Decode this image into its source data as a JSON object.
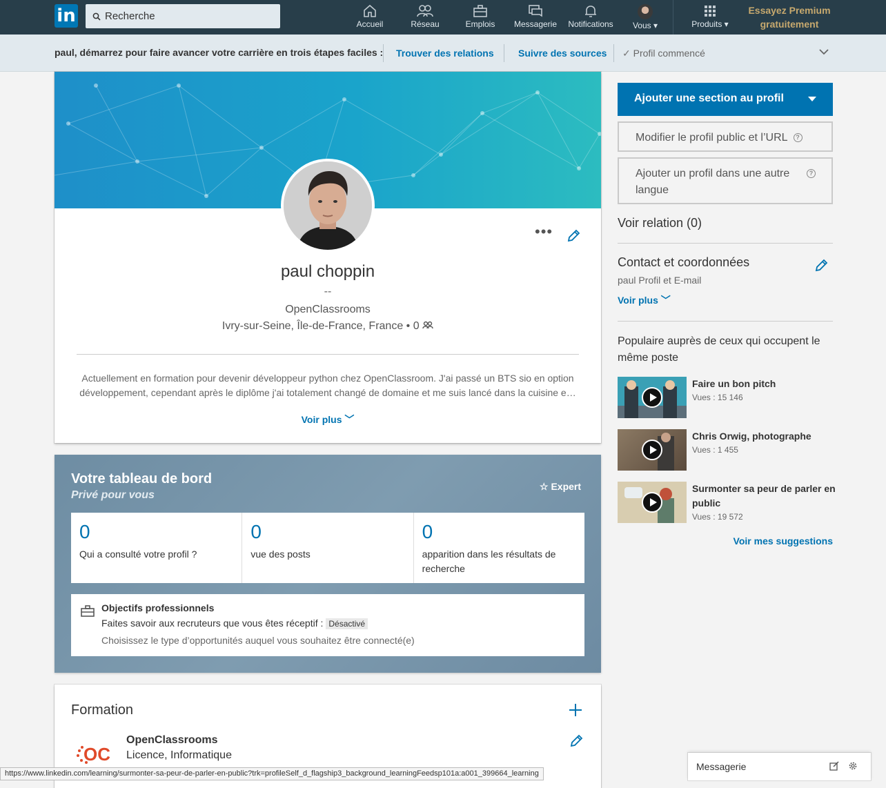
{
  "nav": {
    "logo": "in",
    "search_placeholder": "Recherche",
    "items": [
      {
        "label": "Accueil",
        "icon": "home-icon"
      },
      {
        "label": "Réseau",
        "icon": "network-icon"
      },
      {
        "label": "Emplois",
        "icon": "jobs-icon"
      },
      {
        "label": "Messagerie",
        "icon": "messaging-icon"
      },
      {
        "label": "Notifications",
        "icon": "bell-icon"
      },
      {
        "label": "Vous",
        "icon": "avatar"
      }
    ],
    "products": "Produits",
    "premium": "Essayez Premium gratuitement"
  },
  "steps": {
    "intro": "paul, démarrez pour faire avancer votre carrière en trois étapes faciles :",
    "step1": "Trouver des relations",
    "step2": "Suivre des sources",
    "step3": "Profil commencé"
  },
  "profile": {
    "name": "paul choppin",
    "headline": "--",
    "company": "OpenClassrooms",
    "location": "Ivry-sur-Seine, Île-de-France, France",
    "connections": "0",
    "summary": "Actuellement en formation pour devenir développeur python chez OpenClassroom. J'ai passé un BTS sio en option développement, cependant après le diplôme j'ai totalement changé de domaine et me suis lancé dans la cuisine e…",
    "see_more": "Voir plus"
  },
  "dashboard": {
    "title": "Votre tableau de bord",
    "subtitle": "Privé pour vous",
    "expert": "Expert",
    "stats": [
      {
        "value": "0",
        "label": "Qui a consulté votre profil ?"
      },
      {
        "value": "0",
        "label": "vue des posts"
      },
      {
        "value": "0",
        "label": "apparition dans les résultats de recherche"
      }
    ],
    "goals_title": "Objectifs professionnels",
    "goals_text": "Faites savoir aux recruteurs que vous êtes réceptif :",
    "goals_badge": "Désactivé",
    "goals_desc": "Choisissez le type d’opportunités auquel vous souhaitez être connecté(e)"
  },
  "education": {
    "title": "Formation",
    "school": "OpenClassrooms",
    "degree": "Licence, Informatique",
    "logo_text": "OC"
  },
  "sidebar": {
    "add_section": "Ajouter une section au profil",
    "edit_public": "Modifier le profil public et l’URL",
    "add_language": "Ajouter un profil dans une autre langue",
    "see_connections": "Voir relation (0)",
    "contact_title": "Contact et coordonnées",
    "contact_sub": "paul Profil et E-mail",
    "see_more": "Voir plus",
    "popular_title": "Populaire auprès de ceux qui occupent le même poste",
    "videos": [
      {
        "title": "Faire un bon pitch",
        "views": "Vues : 15 146"
      },
      {
        "title": "Chris Orwig, photographe",
        "views": "Vues : 1 455"
      },
      {
        "title": "Surmonter sa peur de parler en public",
        "views": "Vues : 19 572"
      }
    ],
    "suggestions": "Voir mes suggestions"
  },
  "status_url": "https://www.linkedin.com/learning/surmonter-sa-peur-de-parler-en-public?trk=profileSelf_d_flagship3_background_learningFeedsp101a:a001_399664_learning",
  "messaging_bar": "Messagerie",
  "colors": {
    "brand": "#0073b1",
    "nav_bg": "#283e4a",
    "premium": "#c7a96e"
  }
}
